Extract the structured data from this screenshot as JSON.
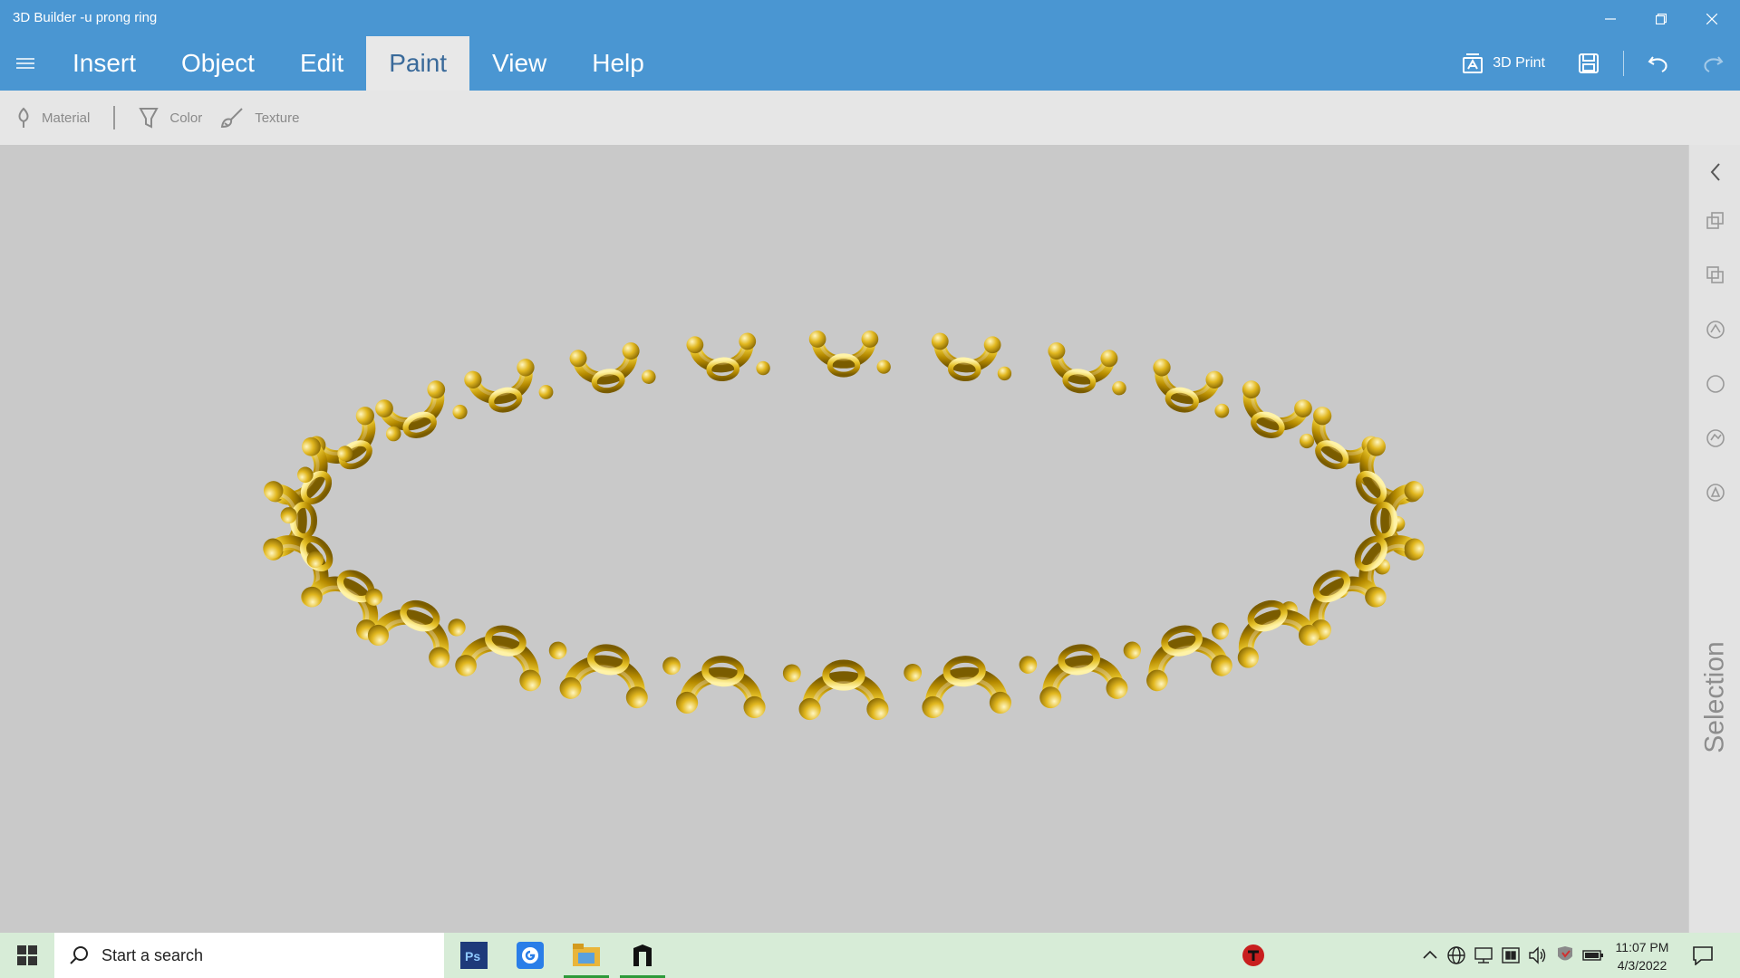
{
  "window": {
    "title": "3D Builder -u prong ring"
  },
  "menu": {
    "tabs": [
      {
        "label": "Insert"
      },
      {
        "label": "Object"
      },
      {
        "label": "Edit"
      },
      {
        "label": "Paint"
      },
      {
        "label": "View"
      },
      {
        "label": "Help"
      }
    ],
    "active_tab": "Paint",
    "print_label": "3D Print"
  },
  "paint_toolbar": {
    "material": "Material",
    "color": "Color",
    "texture": "Texture"
  },
  "sidebar": {
    "label": "Selection",
    "icons": [
      "chevron-left-icon",
      "copy-icon",
      "paste-icon",
      "scale-icon",
      "circle-icon",
      "rotate-icon",
      "settings-icon"
    ]
  },
  "viewport": {
    "model": "u prong ring",
    "model_color": "#d4a800"
  },
  "taskbar": {
    "search_placeholder": "Start a search",
    "apps": [
      "photoshop-icon",
      "google-icon",
      "file-explorer-icon",
      "3d-builder-icon"
    ],
    "time": "11:07 PM",
    "date": "4/3/2022"
  },
  "colors": {
    "accent": "#4a96d2",
    "toolbar_bg": "#e6e6e6",
    "viewport_bg": "#c9c9c9",
    "taskbar_bg": "#d7ecd7"
  }
}
